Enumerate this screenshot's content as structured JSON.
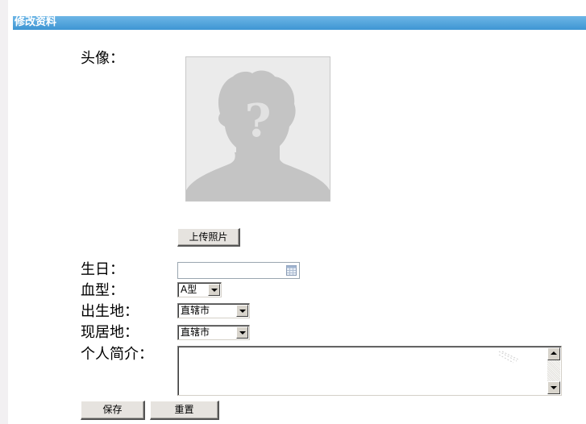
{
  "header": {
    "title": "修改资料",
    "bar_color": "#4aa3e0"
  },
  "form": {
    "avatar_label": "头像：",
    "avatar_icon": "unknown-person-placeholder-icon",
    "upload_button": "上传照片",
    "birthday_label": "生日：",
    "birthday_value": "",
    "calendar_icon": "calendar-icon",
    "blood_type_label": "血型：",
    "blood_type_value": "A型",
    "birthplace_label": "出生地：",
    "birthplace_value": "直辖市",
    "residence_label": "现居地：",
    "residence_value": "直辖市",
    "bio_label": "个人简介：",
    "bio_value": ""
  },
  "actions": {
    "save": "保存",
    "reset": "重置"
  }
}
